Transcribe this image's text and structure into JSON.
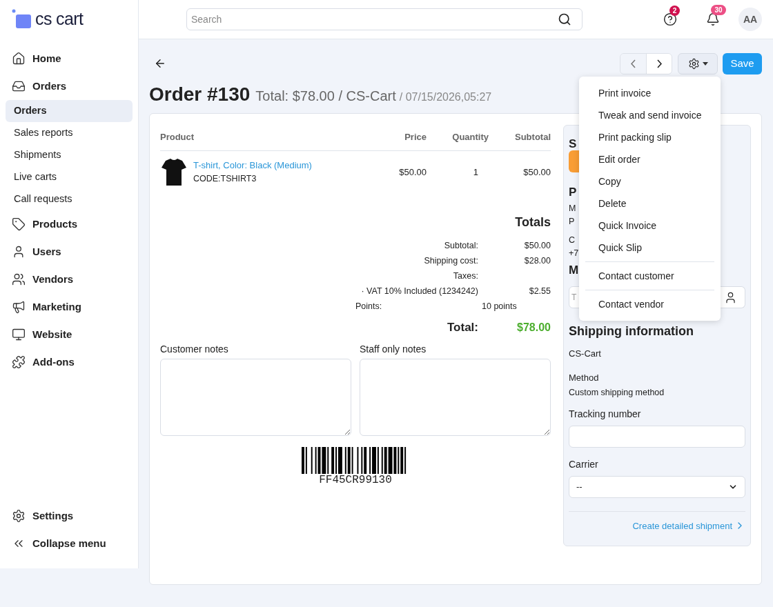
{
  "logo": {
    "text": "cs cart"
  },
  "header": {
    "search": {
      "placeholder": "Search"
    },
    "help_badge": "2",
    "notifications_badge": "30",
    "avatar": "AA"
  },
  "sidebar": {
    "items": [
      {
        "label": "Home"
      },
      {
        "label": "Orders",
        "children": [
          {
            "label": "Orders",
            "selected": true
          },
          {
            "label": "Sales reports",
            "selected": false
          },
          {
            "label": "Shipments",
            "selected": false
          },
          {
            "label": "Live carts",
            "selected": false
          },
          {
            "label": "Call requests",
            "selected": false
          }
        ]
      },
      {
        "label": "Products"
      },
      {
        "label": "Users"
      },
      {
        "label": "Vendors"
      },
      {
        "label": "Marketing"
      },
      {
        "label": "Website"
      },
      {
        "label": "Add-ons"
      }
    ],
    "footer": [
      {
        "label": "Settings"
      },
      {
        "label": "Collapse menu"
      }
    ]
  },
  "toolbar": {
    "save": "Save"
  },
  "order": {
    "title": "Order #130",
    "summary": "Total: $78.00 / CS-Cart",
    "date": "/ 07/15/2026,05:27"
  },
  "table": {
    "columns": [
      "Product",
      "Price",
      "Quantity",
      "Subtotal"
    ],
    "rows": [
      {
        "product": "T-shirt, Color: Black (Medium)",
        "code": "CODE:TSHIRT3",
        "price": "$50.00",
        "quantity": "1",
        "subtotal": "$50.00"
      }
    ]
  },
  "totals": {
    "title": "Totals",
    "rows": [
      {
        "label": "Subtotal:",
        "value": "$50.00"
      },
      {
        "label": "Shipping cost:",
        "value": "$28.00"
      },
      {
        "label": "Taxes:",
        "value": ""
      },
      {
        "label": "· VAT 10% Included (1234242)",
        "value": "$2.55"
      }
    ],
    "points": {
      "label": "Points:",
      "value": "10 points"
    },
    "total": {
      "label": "Total:",
      "value": "$78.00"
    }
  },
  "notes": [
    {
      "label": "Customer notes"
    },
    {
      "label": "Staff only notes"
    }
  ],
  "barcode": {
    "text": "FF45CR99130"
  },
  "side_panel": {
    "status_heading": "S",
    "payment_heading": "P",
    "payment_lines": [
      "M",
      "P"
    ],
    "customer_lines": [
      "C",
      "+7"
    ],
    "manager_heading": "M",
    "manager_placeholder": "T",
    "shipping": {
      "title": "Shipping information",
      "store": "CS-Cart",
      "method_label": "Method",
      "method": "Custom shipping method",
      "tracking_label": "Tracking number",
      "carrier_label": "Carrier",
      "carrier": "--",
      "link": "Create detailed shipment"
    }
  },
  "menu": {
    "groups": [
      [
        "Print invoice",
        "Tweak and send invoice",
        "Print packing slip",
        "Edit order",
        "Copy",
        "Delete",
        "Quick Invoice",
        "Quick Slip"
      ],
      [
        "Contact customer"
      ],
      [
        "Contact vendor"
      ]
    ]
  }
}
